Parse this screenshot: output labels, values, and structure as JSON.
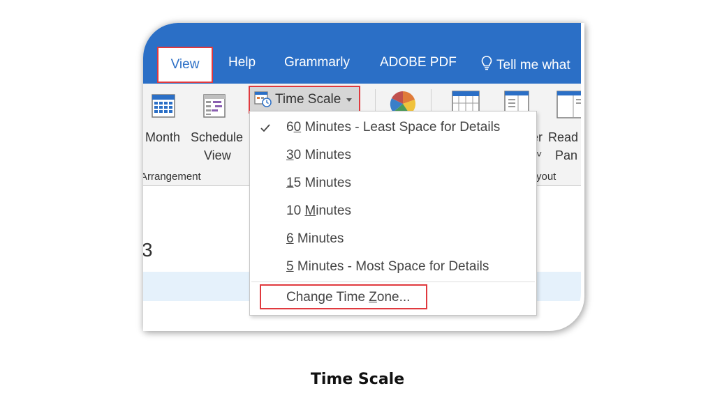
{
  "tabs": {
    "view": "View",
    "help": "Help",
    "grammarly": "Grammarly",
    "adobe_pdf": "ADOBE PDF",
    "tell_me": "Tell me what"
  },
  "ribbon": {
    "month": "Month",
    "schedule_line1": "Schedule",
    "schedule_line2": "View",
    "arrangement": "Arrangement",
    "time_scale": "Time Scale",
    "reader_fragment": "er",
    "reader_arrow": "˅",
    "read_line1": "Read",
    "read_line2": "Pan",
    "layout_fragment": "yout"
  },
  "content": {
    "digit": "3"
  },
  "menu": {
    "items": [
      {
        "pre": "6",
        "u": "0",
        "post": " Minutes - Least Space for Details",
        "checked": true
      },
      {
        "pre": "",
        "u": "3",
        "post": "0 Minutes",
        "checked": false
      },
      {
        "pre": "",
        "u": "1",
        "post": "5 Minutes",
        "checked": false
      },
      {
        "pre": "10 ",
        "u": "M",
        "post": "inutes",
        "checked": false
      },
      {
        "pre": "",
        "u": "6",
        "post": " Minutes",
        "checked": false
      },
      {
        "pre": "",
        "u": "5",
        "post": " Minutes - Most Space for Details",
        "checked": false
      }
    ],
    "change_tz": {
      "pre": "Change Time ",
      "u": "Z",
      "post": "one..."
    }
  },
  "caption": "Time Scale",
  "colors": {
    "tab_bar": "#2b6fc6",
    "highlight_border": "#e0393e",
    "ribbon_bg": "#f3f3f3"
  }
}
